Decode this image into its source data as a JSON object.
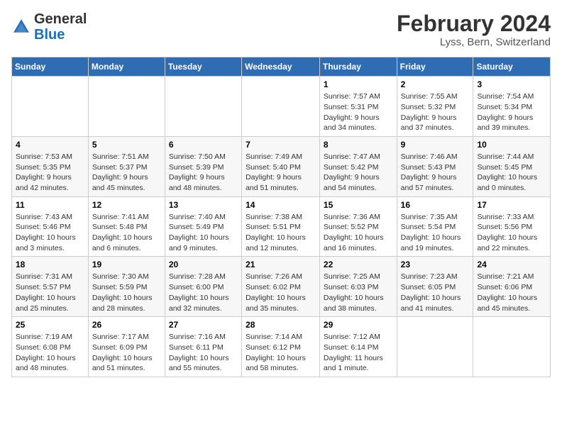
{
  "header": {
    "logo_general": "General",
    "logo_blue": "Blue",
    "month_year": "February 2024",
    "location": "Lyss, Bern, Switzerland"
  },
  "weekdays": [
    "Sunday",
    "Monday",
    "Tuesday",
    "Wednesday",
    "Thursday",
    "Friday",
    "Saturday"
  ],
  "weeks": [
    [
      {
        "day": "",
        "info": ""
      },
      {
        "day": "",
        "info": ""
      },
      {
        "day": "",
        "info": ""
      },
      {
        "day": "",
        "info": ""
      },
      {
        "day": "1",
        "info": "Sunrise: 7:57 AM\nSunset: 5:31 PM\nDaylight: 9 hours and 34 minutes."
      },
      {
        "day": "2",
        "info": "Sunrise: 7:55 AM\nSunset: 5:32 PM\nDaylight: 9 hours and 37 minutes."
      },
      {
        "day": "3",
        "info": "Sunrise: 7:54 AM\nSunset: 5:34 PM\nDaylight: 9 hours and 39 minutes."
      }
    ],
    [
      {
        "day": "4",
        "info": "Sunrise: 7:53 AM\nSunset: 5:35 PM\nDaylight: 9 hours and 42 minutes."
      },
      {
        "day": "5",
        "info": "Sunrise: 7:51 AM\nSunset: 5:37 PM\nDaylight: 9 hours and 45 minutes."
      },
      {
        "day": "6",
        "info": "Sunrise: 7:50 AM\nSunset: 5:39 PM\nDaylight: 9 hours and 48 minutes."
      },
      {
        "day": "7",
        "info": "Sunrise: 7:49 AM\nSunset: 5:40 PM\nDaylight: 9 hours and 51 minutes."
      },
      {
        "day": "8",
        "info": "Sunrise: 7:47 AM\nSunset: 5:42 PM\nDaylight: 9 hours and 54 minutes."
      },
      {
        "day": "9",
        "info": "Sunrise: 7:46 AM\nSunset: 5:43 PM\nDaylight: 9 hours and 57 minutes."
      },
      {
        "day": "10",
        "info": "Sunrise: 7:44 AM\nSunset: 5:45 PM\nDaylight: 10 hours and 0 minutes."
      }
    ],
    [
      {
        "day": "11",
        "info": "Sunrise: 7:43 AM\nSunset: 5:46 PM\nDaylight: 10 hours and 3 minutes."
      },
      {
        "day": "12",
        "info": "Sunrise: 7:41 AM\nSunset: 5:48 PM\nDaylight: 10 hours and 6 minutes."
      },
      {
        "day": "13",
        "info": "Sunrise: 7:40 AM\nSunset: 5:49 PM\nDaylight: 10 hours and 9 minutes."
      },
      {
        "day": "14",
        "info": "Sunrise: 7:38 AM\nSunset: 5:51 PM\nDaylight: 10 hours and 12 minutes."
      },
      {
        "day": "15",
        "info": "Sunrise: 7:36 AM\nSunset: 5:52 PM\nDaylight: 10 hours and 16 minutes."
      },
      {
        "day": "16",
        "info": "Sunrise: 7:35 AM\nSunset: 5:54 PM\nDaylight: 10 hours and 19 minutes."
      },
      {
        "day": "17",
        "info": "Sunrise: 7:33 AM\nSunset: 5:56 PM\nDaylight: 10 hours and 22 minutes."
      }
    ],
    [
      {
        "day": "18",
        "info": "Sunrise: 7:31 AM\nSunset: 5:57 PM\nDaylight: 10 hours and 25 minutes."
      },
      {
        "day": "19",
        "info": "Sunrise: 7:30 AM\nSunset: 5:59 PM\nDaylight: 10 hours and 28 minutes."
      },
      {
        "day": "20",
        "info": "Sunrise: 7:28 AM\nSunset: 6:00 PM\nDaylight: 10 hours and 32 minutes."
      },
      {
        "day": "21",
        "info": "Sunrise: 7:26 AM\nSunset: 6:02 PM\nDaylight: 10 hours and 35 minutes."
      },
      {
        "day": "22",
        "info": "Sunrise: 7:25 AM\nSunset: 6:03 PM\nDaylight: 10 hours and 38 minutes."
      },
      {
        "day": "23",
        "info": "Sunrise: 7:23 AM\nSunset: 6:05 PM\nDaylight: 10 hours and 41 minutes."
      },
      {
        "day": "24",
        "info": "Sunrise: 7:21 AM\nSunset: 6:06 PM\nDaylight: 10 hours and 45 minutes."
      }
    ],
    [
      {
        "day": "25",
        "info": "Sunrise: 7:19 AM\nSunset: 6:08 PM\nDaylight: 10 hours and 48 minutes."
      },
      {
        "day": "26",
        "info": "Sunrise: 7:17 AM\nSunset: 6:09 PM\nDaylight: 10 hours and 51 minutes."
      },
      {
        "day": "27",
        "info": "Sunrise: 7:16 AM\nSunset: 6:11 PM\nDaylight: 10 hours and 55 minutes."
      },
      {
        "day": "28",
        "info": "Sunrise: 7:14 AM\nSunset: 6:12 PM\nDaylight: 10 hours and 58 minutes."
      },
      {
        "day": "29",
        "info": "Sunrise: 7:12 AM\nSunset: 6:14 PM\nDaylight: 11 hours and 1 minute."
      },
      {
        "day": "",
        "info": ""
      },
      {
        "day": "",
        "info": ""
      }
    ]
  ]
}
